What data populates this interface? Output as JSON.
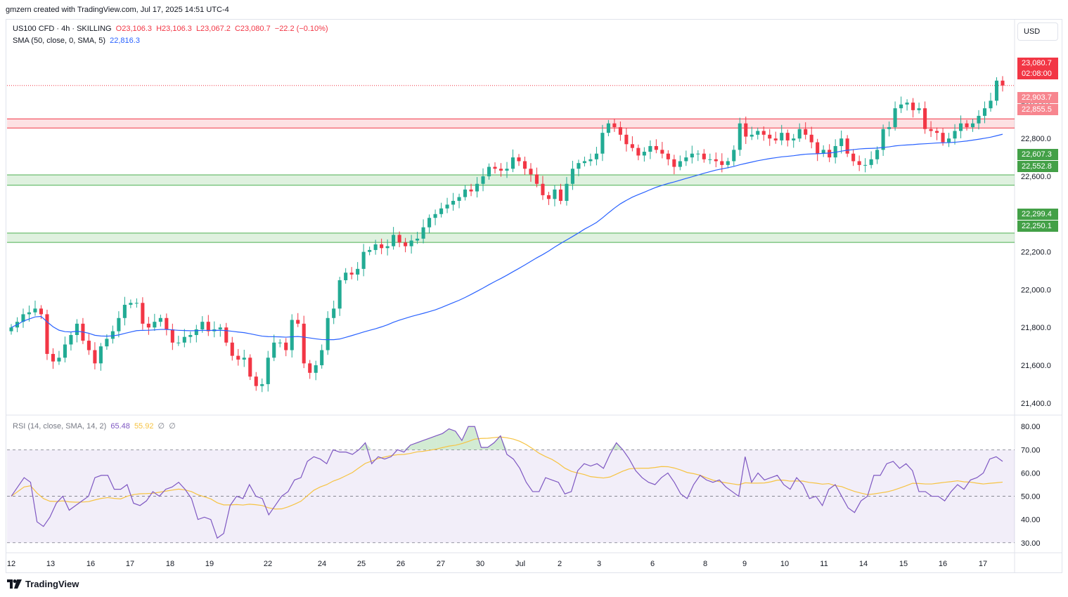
{
  "header": {
    "text": "gmzern created with TradingView.com, Jul 17, 2025 14:51 UTC-4"
  },
  "legend": {
    "symbol": "US100 CFD · 4h · SKILLING",
    "open": "O23,106.3",
    "high": "H23,106.3",
    "low": "L23,067.2",
    "close": "C23,080.7",
    "change": "−22.2 (−0.10%)",
    "sma_label": "SMA (50, close, 0, SMA, 5)",
    "sma_value": "22,816.3",
    "rsi_label": "RSI (14, close, SMA, 14, 2)",
    "rsi_value": "65.48",
    "rsi_ma_value": "55.92",
    "rsi_extra1": "∅",
    "rsi_extra2": "∅"
  },
  "currency_button": "USD",
  "price_labels": {
    "last_price": "23,080.7",
    "countdown": "02:08:00",
    "zone_red_top": "22,903.7",
    "zone_red_bottom": "22,855.5",
    "zone_green1_top": "22,607.3",
    "zone_green1_bottom": "22,552.8",
    "zone_green2_top": "22,299.4",
    "zone_green2_bottom": "22,250.1"
  },
  "logo_text": "TradingView",
  "colors": {
    "up": "#22ab94",
    "down": "#f23645",
    "sma": "#2962ff",
    "rsi": "#7e57c2",
    "rsi_ma": "#f6c342",
    "zone_red": "#f23645",
    "zone_green": "#4caf50"
  },
  "chart_data": {
    "type": "candlestick",
    "title": "US100 CFD · 4h · SKILLING",
    "y_axis": {
      "ticks": [
        21400,
        21600,
        21800,
        22000,
        22200,
        22400,
        22600,
        22800,
        23000
      ],
      "tick_labels": [
        "21,400.0",
        "21,600.0",
        "21,800.0",
        "22,000.0",
        "22,200.0",
        "22,400.0",
        "22,600.0",
        "22,800.0",
        "23,000.0"
      ],
      "ylim": [
        21340,
        23310
      ]
    },
    "x_axis": {
      "tick_labels": [
        "12",
        "13",
        "16",
        "17",
        "18",
        "19",
        "22",
        "24",
        "25",
        "26",
        "27",
        "30",
        "Jul",
        "2",
        "3",
        "6",
        "8",
        "9",
        "10",
        "11",
        "14",
        "15",
        "16",
        "17"
      ]
    },
    "zones": [
      {
        "name": "resistance",
        "top": 22903.7,
        "bottom": 22855.5,
        "color": "red"
      },
      {
        "name": "support-1",
        "top": 22607.3,
        "bottom": 22552.8,
        "color": "green"
      },
      {
        "name": "support-2",
        "top": 22299.4,
        "bottom": 22250.1,
        "color": "green"
      }
    ],
    "last_price": 23080.7,
    "candles_close": [
      21800,
      21830,
      21870,
      21880,
      21900,
      21870,
      21660,
      21620,
      21640,
      21710,
      21760,
      21820,
      21730,
      21680,
      21610,
      21700,
      21740,
      21780,
      21850,
      21920,
      21930,
      21930,
      21820,
      21800,
      21830,
      21850,
      21790,
      21720,
      21720,
      21750,
      21760,
      21790,
      21830,
      21780,
      21790,
      21800,
      21720,
      21650,
      21630,
      21640,
      21540,
      21490,
      21500,
      21640,
      21720,
      21720,
      21680,
      21840,
      21820,
      21610,
      21560,
      21600,
      21680,
      21850,
      21900,
      22050,
      22090,
      22080,
      22110,
      22200,
      22210,
      22240,
      22220,
      22230,
      22290,
      22250,
      22230,
      22260,
      22270,
      22330,
      22380,
      22400,
      22430,
      22450,
      22470,
      22490,
      22530,
      22520,
      22560,
      22600,
      22650,
      22640,
      22630,
      22640,
      22700,
      22680,
      22640,
      22610,
      22560,
      22500,
      22480,
      22530,
      22470,
      22560,
      22640,
      22670,
      22680,
      22690,
      22720,
      22830,
      22880,
      22860,
      22820,
      22770,
      22750,
      22710,
      22730,
      22760,
      22740,
      22720,
      22690,
      22650,
      22680,
      22700,
      22720,
      22720,
      22690,
      22690,
      22680,
      22660,
      22680,
      22740,
      22880,
      22810,
      22820,
      22840,
      22820,
      22800,
      22790,
      22830,
      22790,
      22800,
      22850,
      22820,
      22780,
      22720,
      22740,
      22700,
      22760,
      22800,
      22720,
      22680,
      22660,
      22660,
      22690,
      22740,
      22850,
      22860,
      22960,
      22980,
      22990,
      22950,
      22960,
      22850,
      22840,
      22830,
      22780,
      22800,
      22840,
      22880,
      22860,
      22880,
      22920,
      22960,
      23000,
      23106.3,
      23080.7
    ],
    "sma_50_close": 22816.3,
    "rsi": {
      "label": "RSI (14, close, SMA, 14, 2)",
      "value": 65.48,
      "ma_value": 55.92,
      "levels": {
        "upper": 70,
        "middle": 50,
        "lower": 30
      },
      "tick_labels": [
        "30.00",
        "40.00",
        "50.00",
        "60.00",
        "70.00",
        "80.00"
      ],
      "ylim": [
        26,
        84
      ],
      "values": [
        50,
        54,
        58,
        56,
        39,
        37,
        41,
        47,
        50,
        44,
        46,
        48,
        50,
        58,
        59,
        59,
        53,
        53,
        55,
        47,
        46,
        48,
        52,
        50,
        53,
        54,
        56,
        53,
        49,
        40,
        41,
        40,
        32,
        34,
        46,
        50,
        49,
        55,
        50,
        49,
        42,
        46,
        50,
        52,
        57,
        58,
        65,
        67,
        66,
        64,
        70,
        69,
        69,
        68,
        70,
        73,
        64,
        67,
        66,
        67,
        70,
        69,
        72,
        73,
        74,
        75,
        76,
        77,
        79,
        78,
        74,
        80,
        80,
        71,
        71,
        73,
        76,
        68,
        66,
        62,
        56,
        52,
        52,
        58,
        57,
        56,
        51,
        52,
        61,
        64,
        63,
        64,
        62,
        68,
        73,
        70,
        66,
        61,
        58,
        56,
        55,
        58,
        60,
        56,
        51,
        49,
        55,
        59,
        57,
        56,
        57,
        54,
        52,
        50,
        67,
        56,
        60,
        57,
        58,
        59,
        55,
        53,
        58,
        55,
        49,
        50,
        46,
        53,
        55,
        50,
        45,
        43,
        48,
        50,
        59,
        59,
        64,
        65,
        62,
        64,
        61,
        52,
        52,
        50,
        50,
        48,
        52,
        55,
        53,
        57,
        58,
        60,
        66,
        67,
        65
      ]
    }
  }
}
